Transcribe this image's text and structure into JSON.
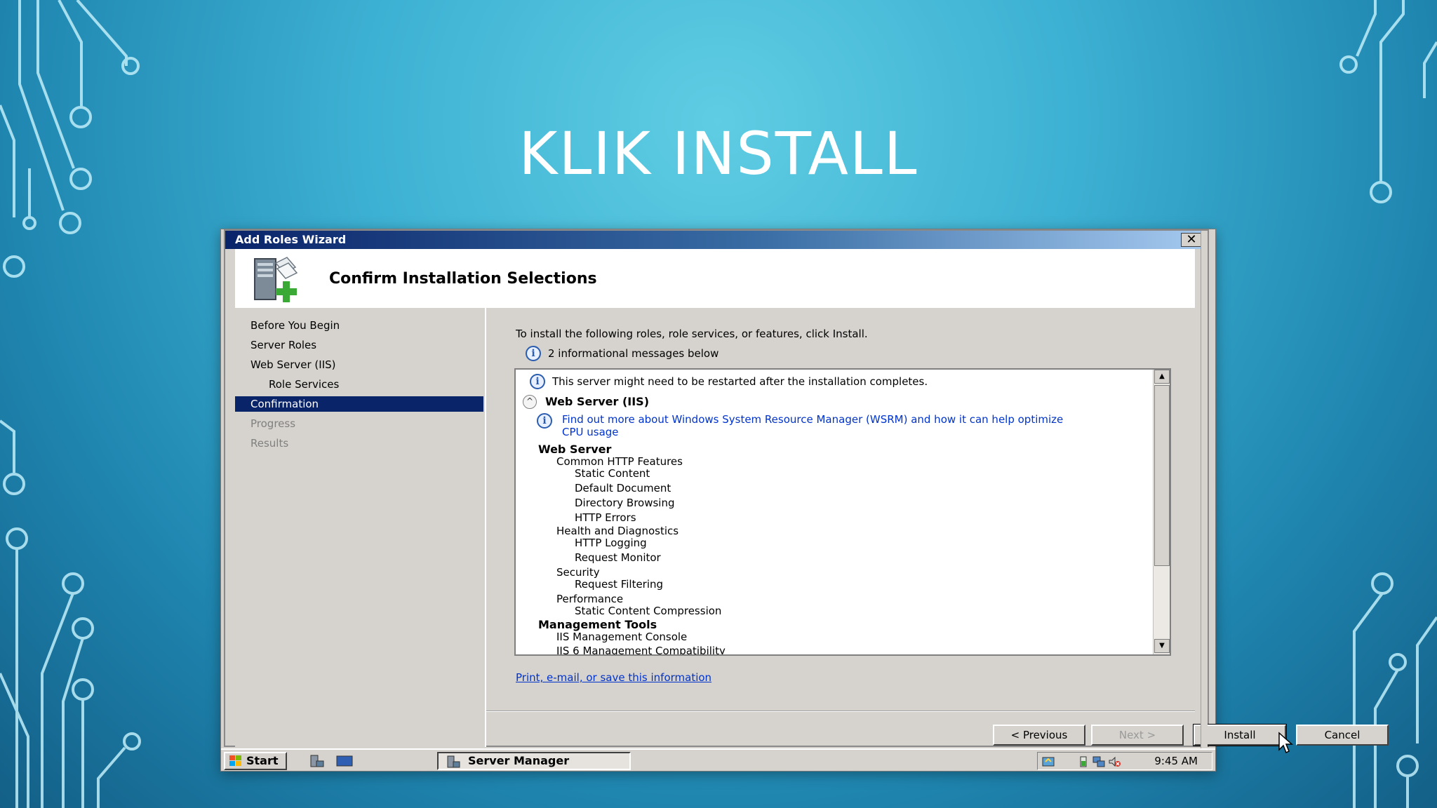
{
  "slide": {
    "title": "KLIK INSTALL"
  },
  "window": {
    "title": "Add Roles Wizard",
    "close_label": "✕"
  },
  "header": {
    "title": "Confirm Installation Selections",
    "icon": "server-add-icon"
  },
  "nav": {
    "items": [
      {
        "label": "Before You Begin",
        "state": "done"
      },
      {
        "label": "Server Roles",
        "state": "done"
      },
      {
        "label": "Web Server (IIS)",
        "state": "done"
      },
      {
        "label": "Role Services",
        "state": "done"
      },
      {
        "label": "Confirmation",
        "state": "active"
      },
      {
        "label": "Progress",
        "state": "disabled"
      },
      {
        "label": "Results",
        "state": "disabled"
      }
    ]
  },
  "content": {
    "intro": "To install the following roles, role services, or features, click Install.",
    "messages_count": "2 informational messages below",
    "list": {
      "restart_note": "This server might need to be restarted after the installation completes.",
      "section_title": "Web Server (IIS)",
      "wsrm_link_line1": "Find out more about Windows System Resource Manager (WSRM) and how it can help optimize",
      "wsrm_link_line2": "CPU usage",
      "rows": [
        {
          "text": "Web Server",
          "level": 0
        },
        {
          "text": "Common HTTP Features",
          "level": 1
        },
        {
          "text": "Static Content",
          "level": 2
        },
        {
          "text": "Default Document",
          "level": 2
        },
        {
          "text": "Directory Browsing",
          "level": 2
        },
        {
          "text": "HTTP Errors",
          "level": 2
        },
        {
          "text": "Health and Diagnostics",
          "level": 1
        },
        {
          "text": "HTTP Logging",
          "level": 2
        },
        {
          "text": "Request Monitor",
          "level": 2
        },
        {
          "text": "Security",
          "level": 1
        },
        {
          "text": "Request Filtering",
          "level": 2
        },
        {
          "text": "Performance",
          "level": 1
        },
        {
          "text": "Static Content Compression",
          "level": 2
        },
        {
          "text": "Management Tools",
          "level": 0
        },
        {
          "text": "IIS Management Console",
          "level": 1
        },
        {
          "text": "IIS 6 Management Compatibility",
          "level": 1
        }
      ]
    },
    "print_link": "Print, e-mail, or save this information"
  },
  "buttons": {
    "previous": "< Previous",
    "next": "Next >",
    "install": "Install",
    "cancel": "Cancel"
  },
  "taskbar": {
    "start": "Start",
    "task": "Server Manager",
    "clock": "9:45 AM"
  },
  "colors": {
    "selection": "#0a246a",
    "link": "#0033cc",
    "dialog_bg": "#d6d3ce"
  }
}
